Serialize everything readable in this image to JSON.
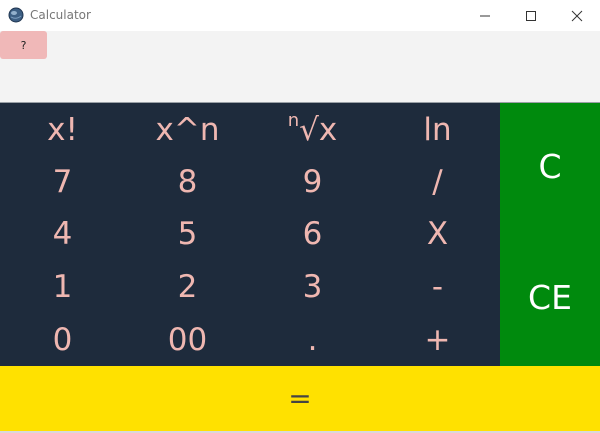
{
  "window": {
    "title": "Calculator",
    "icon": "calculator-globe-icon",
    "controls": [
      "minimize-icon",
      "maximize-icon",
      "close-icon"
    ]
  },
  "help_button": {
    "label": "?"
  },
  "keypad": {
    "function_row": [
      "x!",
      "x^n",
      "√x",
      "ln"
    ],
    "root_superscript": "n",
    "rows": [
      [
        "7",
        "8",
        "9",
        "/"
      ],
      [
        "4",
        "5",
        "6",
        "X"
      ],
      [
        "1",
        "2",
        "3",
        "-"
      ],
      [
        "0",
        "00",
        ".",
        "+"
      ]
    ]
  },
  "side_panel": {
    "clear_label": "C",
    "clear_entry_label": "CE"
  },
  "equals": {
    "label": "="
  },
  "colors": {
    "keypad_bg": "#1e2b3c",
    "key_text": "#efb7b1",
    "side_panel_bg": "#008a0d",
    "equals_bg": "#ffe100",
    "help_button_bg": "#f0b8b8"
  }
}
